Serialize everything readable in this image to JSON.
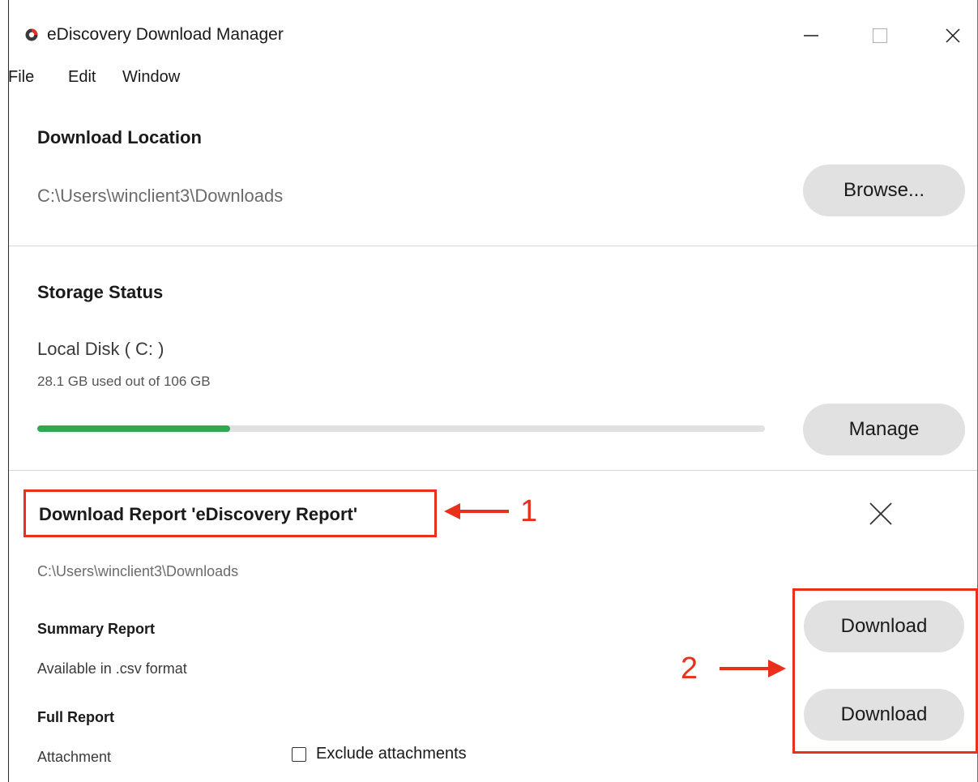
{
  "window": {
    "title": "eDiscovery Download Manager",
    "icon": "app-logo-icon",
    "controls": [
      "minimize-icon",
      "maximize-icon",
      "close-icon"
    ]
  },
  "menu": {
    "items": [
      "File",
      "Edit",
      "Window"
    ]
  },
  "download_location": {
    "title": "Download Location",
    "path": "C:\\Users\\winclient3\\Downloads",
    "browse_label": "Browse..."
  },
  "storage_status": {
    "title": "Storage Status",
    "disk_name": "Local Disk ( C: )",
    "usage_text": "28.1 GB used out of 106 GB",
    "used_gb": 28.1,
    "total_gb": 106,
    "usage_fraction": 0.265,
    "bar_color": "#2fa84f",
    "manage_label": "Manage"
  },
  "report": {
    "title": "Download Report 'eDiscovery Report'",
    "path": "C:\\Users\\winclient3\\Downloads",
    "summary": {
      "title": "Summary Report",
      "format": "Available in .csv format",
      "button_label": "Download"
    },
    "full": {
      "title": "Full Report",
      "attachment_label": "Attachment",
      "exclude_label": "Exclude attachments",
      "exclude_checked": false,
      "button_label": "Download"
    }
  },
  "annotations": {
    "color": "#e8301c",
    "callout_1": "1",
    "callout_2": "2"
  }
}
